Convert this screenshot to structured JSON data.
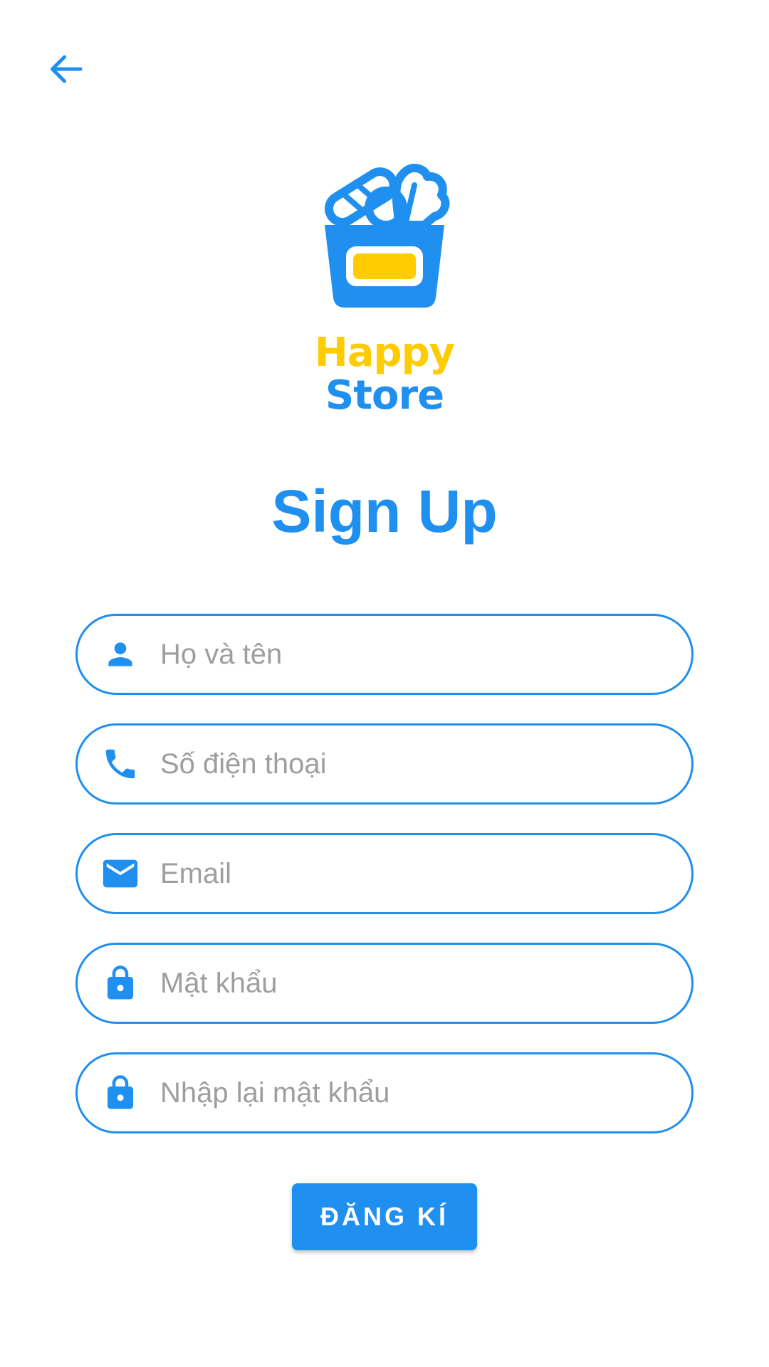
{
  "colors": {
    "primary": "#1f8ff0",
    "accent_yellow": "#ffcc00",
    "placeholder": "#9e9e9e",
    "background": "#ffffff"
  },
  "header": {
    "back_icon": "arrow-left-icon"
  },
  "logo": {
    "line1": "Happy",
    "line2": "Store"
  },
  "title": "Sign Up",
  "form": {
    "fields": [
      {
        "icon": "person-icon",
        "placeholder": "Họ và tên",
        "value": ""
      },
      {
        "icon": "phone-icon",
        "placeholder": "Số điện thoại",
        "value": ""
      },
      {
        "icon": "email-icon",
        "placeholder": "Email",
        "value": ""
      },
      {
        "icon": "lock-icon",
        "placeholder": "Mật khẩu",
        "value": ""
      },
      {
        "icon": "lock-icon",
        "placeholder": "Nhập lại mật khẩu",
        "value": ""
      }
    ],
    "submit_label": "ĐĂNG KÍ"
  }
}
